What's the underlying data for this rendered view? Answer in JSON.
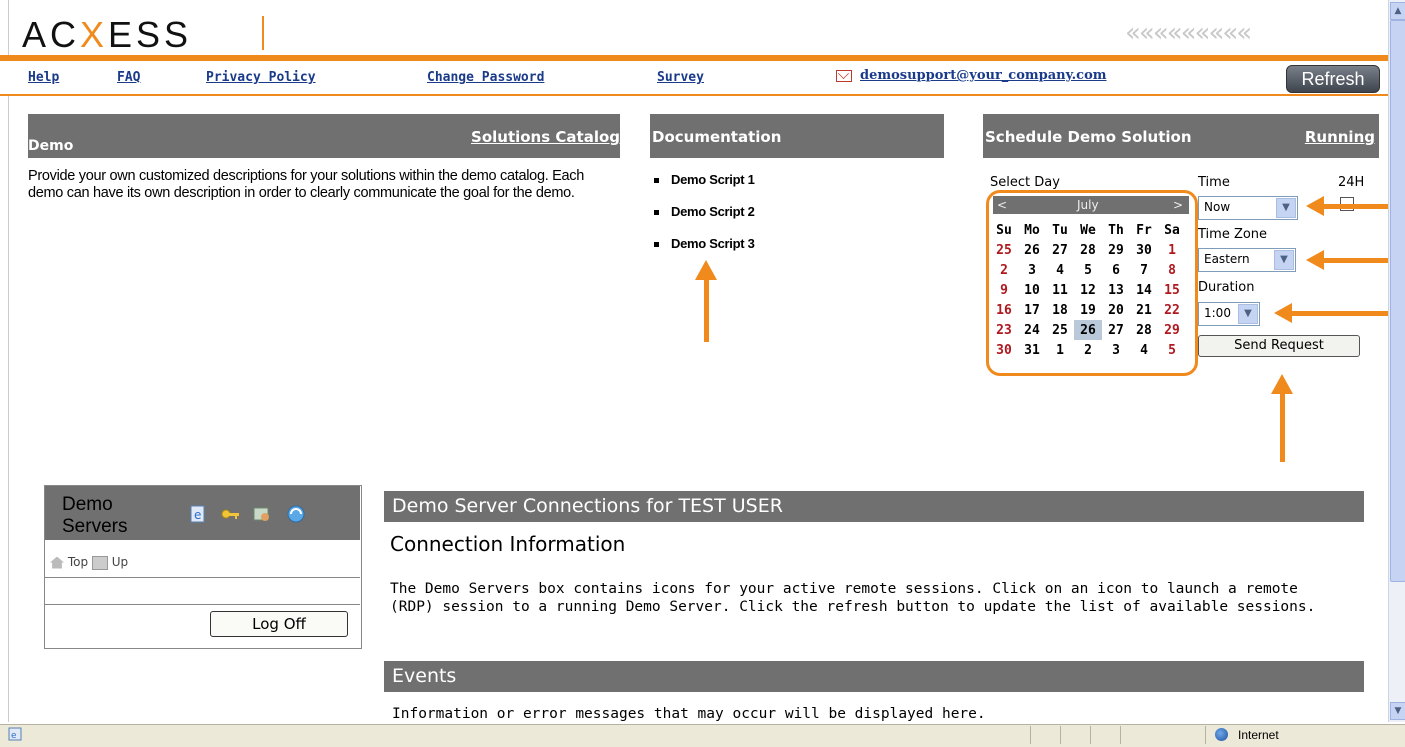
{
  "brand": {
    "logo_pre": "AC",
    "logo_x": "X",
    "logo_post": "ESS",
    "chevrons": "«««««««««"
  },
  "nav": {
    "help": "Help",
    "faq": "FAQ",
    "privacy": "Privacy Policy",
    "change_password": "Change Password",
    "survey": "Survey",
    "email": "demosupport@your_company.com",
    "refresh": "Refresh"
  },
  "demo_panel": {
    "title": "Demo",
    "catalog_link": "Solutions Catalog",
    "description": "Provide your own customized descriptions for your solutions within the demo catalog.  Each demo can have its own description in order to clearly communicate the goal for the demo."
  },
  "documentation": {
    "title": "Documentation",
    "items": [
      "Demo Script 1",
      "Demo Script 2",
      "Demo Script 3"
    ]
  },
  "schedule": {
    "title": "Schedule Demo Solution",
    "running_link": "Running",
    "select_day_label": "Select Day",
    "time_label": "Time",
    "label_24h": "24H",
    "time_value": "Now",
    "timezone_label": "Time Zone",
    "timezone_value": "Eastern",
    "duration_label": "Duration",
    "duration_value": "1:00",
    "send_button": "Send Request",
    "calendar": {
      "month": "July",
      "prev": "<",
      "next": ">",
      "weekdays": [
        "Su",
        "Mo",
        "Tu",
        "We",
        "Th",
        "Fr",
        "Sa"
      ],
      "weeks": [
        [
          "25",
          "26",
          "27",
          "28",
          "29",
          "30",
          "1"
        ],
        [
          "2",
          "3",
          "4",
          "5",
          "6",
          "7",
          "8"
        ],
        [
          "9",
          "10",
          "11",
          "12",
          "13",
          "14",
          "15"
        ],
        [
          "16",
          "17",
          "18",
          "19",
          "20",
          "21",
          "22"
        ],
        [
          "23",
          "24",
          "25",
          "26",
          "27",
          "28",
          "29"
        ],
        [
          "30",
          "31",
          "1",
          "2",
          "3",
          "4",
          "5"
        ]
      ],
      "today": "26"
    }
  },
  "demo_servers": {
    "title_line1": "Demo",
    "title_line2": "Servers",
    "icons": [
      "ie-icon",
      "key-icon",
      "tools-icon",
      "refresh-globe-icon"
    ],
    "top": "Top",
    "up": "Up",
    "log_off": "Log Off"
  },
  "connections": {
    "bar_title": "Demo Server Connections for TEST  USER",
    "heading": "Connection Information",
    "text": "The Demo Servers box contains icons for your active remote sessions. Click on an icon to launch a remote (RDP) session to a running Demo Server. Click the refresh button to update the list of available sessions.",
    "events_title": "Events",
    "events_text": "Information or error messages that may occur will be displayed here."
  },
  "statusbar": {
    "zone": "Internet"
  },
  "colors": {
    "accent": "#f08a1c",
    "panel_gray": "#707070",
    "link_blue": "#1a3a8a",
    "weekend_red": "#b0181f"
  }
}
